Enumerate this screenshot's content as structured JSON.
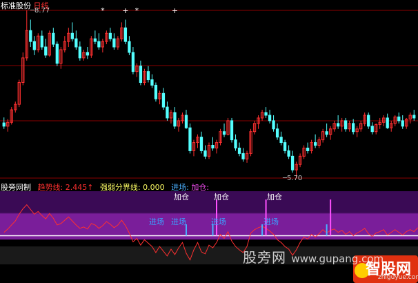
{
  "top_bar": {
    "indicator_name": "标准股份",
    "period": "日线"
  },
  "price_panel": {
    "high_label": "8.77",
    "low_label": "5.70",
    "markers": [
      "*",
      "+",
      "*",
      "+",
      "+"
    ]
  },
  "indicator_panel": {
    "name": "股旁网制",
    "trend_label": "趋势线:",
    "trend_value": "2.445↑",
    "boundary_label": "强弱分界线:",
    "boundary_value": "0.000",
    "entry_label": "进场:",
    "add_label": "加仓:",
    "add_marks": [
      "加仓",
      "加仓",
      "加仓"
    ],
    "entry_marks": [
      "进场",
      "进场",
      "进场",
      "进场"
    ]
  },
  "watermark": {
    "site_name": "股旁网",
    "url": "www.gupang.com"
  },
  "logo": {
    "main": "智股网",
    "sub": "zhiguyue.com"
  },
  "colors": {
    "background": "#000000",
    "up_candle": "#ff3030",
    "down_candle": "#54ffff",
    "grid": "#8b0000",
    "band_dark": "#3a0a55",
    "band_light": "#7a1e9a",
    "trend_line": "#ff3030",
    "boundary_line": "#ffffff",
    "add_signal": "#ff50ff",
    "entry_signal": "#4ab0ff",
    "title_text": "#ffffff",
    "period_text": "#ff3030",
    "trend_text": "#ff3030",
    "boundary_text": "#ffff66",
    "entry_text": "#4ab0ff",
    "add_text": "#ff50ff"
  },
  "chart_data": {
    "type": "candlestick",
    "price_high": 8.77,
    "price_low": 5.7,
    "ohlc": [
      [
        6.71,
        6.81,
        6.6,
        6.65
      ],
      [
        6.65,
        6.78,
        6.55,
        6.72
      ],
      [
        6.72,
        7.0,
        6.68,
        6.95
      ],
      [
        6.95,
        7.1,
        6.9,
        7.05
      ],
      [
        7.05,
        7.5,
        7.0,
        7.45
      ],
      [
        7.45,
        8.0,
        7.4,
        7.9
      ],
      [
        7.9,
        8.77,
        7.85,
        8.4
      ],
      [
        8.4,
        8.6,
        8.1,
        8.2
      ],
      [
        8.2,
        8.3,
        7.95,
        8.05
      ],
      [
        8.05,
        8.35,
        8.0,
        8.3
      ],
      [
        8.3,
        8.4,
        8.05,
        8.1
      ],
      [
        8.1,
        8.25,
        7.9,
        7.95
      ],
      [
        7.95,
        8.4,
        7.92,
        8.35
      ],
      [
        8.35,
        8.45,
        8.1,
        8.15
      ],
      [
        8.15,
        8.2,
        7.75,
        7.8
      ],
      [
        7.8,
        8.1,
        7.7,
        8.05
      ],
      [
        8.05,
        8.3,
        8.0,
        8.2
      ],
      [
        8.2,
        8.45,
        8.1,
        8.35
      ],
      [
        8.35,
        8.55,
        8.2,
        8.25
      ],
      [
        8.25,
        8.4,
        8.05,
        8.1
      ],
      [
        8.1,
        8.2,
        7.85,
        7.9
      ],
      [
        7.9,
        8.05,
        7.85,
        8.0
      ],
      [
        8.0,
        8.1,
        7.88,
        7.95
      ],
      [
        7.95,
        8.3,
        7.9,
        8.25
      ],
      [
        8.25,
        8.4,
        8.15,
        8.2
      ],
      [
        8.2,
        8.35,
        8.05,
        8.1
      ],
      [
        8.1,
        8.25,
        8.0,
        8.2
      ],
      [
        8.2,
        8.4,
        8.15,
        8.35
      ],
      [
        8.35,
        8.45,
        8.2,
        8.25
      ],
      [
        8.25,
        8.35,
        8.05,
        8.1
      ],
      [
        8.1,
        8.3,
        8.05,
        8.25
      ],
      [
        8.25,
        8.55,
        8.2,
        8.45
      ],
      [
        8.45,
        8.6,
        8.15,
        8.2
      ],
      [
        8.2,
        8.3,
        7.95,
        8.0
      ],
      [
        8.0,
        8.1,
        7.6,
        7.65
      ],
      [
        7.65,
        7.8,
        7.55,
        7.75
      ],
      [
        7.75,
        7.85,
        7.4,
        7.45
      ],
      [
        7.45,
        7.7,
        7.4,
        7.65
      ],
      [
        7.65,
        7.75,
        7.45,
        7.5
      ],
      [
        7.5,
        7.6,
        7.35,
        7.4
      ],
      [
        7.4,
        7.45,
        7.1,
        7.15
      ],
      [
        7.15,
        7.3,
        7.05,
        7.25
      ],
      [
        7.25,
        7.35,
        6.95,
        7.0
      ],
      [
        7.0,
        7.1,
        6.75,
        6.8
      ],
      [
        6.8,
        6.95,
        6.7,
        6.9
      ],
      [
        6.9,
        7.0,
        6.6,
        6.65
      ],
      [
        6.65,
        6.8,
        6.55,
        6.75
      ],
      [
        6.75,
        6.9,
        6.7,
        6.85
      ],
      [
        6.85,
        6.95,
        6.6,
        6.62
      ],
      [
        6.62,
        6.7,
        6.15,
        6.2
      ],
      [
        6.2,
        6.4,
        6.1,
        6.35
      ],
      [
        6.35,
        6.5,
        6.25,
        6.45
      ],
      [
        6.45,
        6.55,
        6.15,
        6.2
      ],
      [
        6.2,
        6.3,
        6.05,
        6.1
      ],
      [
        6.1,
        6.35,
        6.05,
        6.3
      ],
      [
        6.3,
        6.45,
        6.2,
        6.25
      ],
      [
        6.25,
        6.4,
        6.15,
        6.35
      ],
      [
        6.35,
        6.6,
        6.3,
        6.55
      ],
      [
        6.55,
        6.7,
        6.45,
        6.5
      ],
      [
        6.5,
        6.8,
        6.48,
        6.75
      ],
      [
        6.75,
        6.8,
        6.35,
        6.4
      ],
      [
        6.4,
        6.5,
        6.2,
        6.25
      ],
      [
        6.25,
        6.35,
        6.1,
        6.15
      ],
      [
        6.15,
        6.25,
        6.0,
        6.05
      ],
      [
        6.05,
        6.2,
        5.98,
        6.15
      ],
      [
        6.15,
        6.6,
        6.1,
        6.55
      ],
      [
        6.55,
        6.75,
        6.5,
        6.7
      ],
      [
        6.7,
        6.85,
        6.6,
        6.8
      ],
      [
        6.8,
        6.95,
        6.75,
        6.9
      ],
      [
        6.9,
        7.0,
        6.8,
        6.85
      ],
      [
        6.85,
        6.95,
        6.7,
        6.75
      ],
      [
        6.75,
        6.85,
        6.55,
        6.6
      ],
      [
        6.6,
        6.7,
        6.4,
        6.45
      ],
      [
        6.45,
        6.55,
        6.3,
        6.35
      ],
      [
        6.35,
        6.4,
        6.15,
        6.2
      ],
      [
        6.2,
        6.3,
        6.05,
        6.1
      ],
      [
        6.1,
        6.2,
        5.8,
        5.85
      ],
      [
        5.85,
        6.0,
        5.7,
        5.95
      ],
      [
        5.95,
        6.15,
        5.9,
        6.1
      ],
      [
        6.1,
        6.3,
        6.05,
        6.25
      ],
      [
        6.25,
        6.35,
        6.15,
        6.2
      ],
      [
        6.2,
        6.4,
        6.15,
        6.35
      ],
      [
        6.35,
        6.5,
        6.25,
        6.3
      ],
      [
        6.3,
        6.45,
        6.25,
        6.4
      ],
      [
        6.4,
        6.6,
        6.35,
        6.55
      ],
      [
        6.55,
        6.7,
        6.45,
        6.5
      ],
      [
        6.5,
        6.65,
        6.4,
        6.6
      ],
      [
        6.6,
        6.75,
        6.55,
        6.7
      ],
      [
        6.7,
        6.85,
        6.6,
        6.65
      ],
      [
        6.65,
        6.8,
        6.55,
        6.75
      ],
      [
        6.75,
        6.8,
        6.55,
        6.6
      ],
      [
        6.6,
        6.75,
        6.55,
        6.7
      ],
      [
        6.7,
        6.78,
        6.5,
        6.55
      ],
      [
        6.55,
        6.65,
        6.45,
        6.6
      ],
      [
        6.6,
        6.75,
        6.55,
        6.7
      ],
      [
        6.7,
        6.9,
        6.65,
        6.85
      ],
      [
        6.85,
        6.9,
        6.6,
        6.65
      ],
      [
        6.65,
        6.72,
        6.5,
        6.55
      ],
      [
        6.55,
        6.7,
        6.5,
        6.68
      ],
      [
        6.68,
        6.8,
        6.6,
        6.72
      ],
      [
        6.72,
        6.85,
        6.65,
        6.8
      ],
      [
        6.8,
        6.88,
        6.6,
        6.62
      ],
      [
        6.62,
        6.75,
        6.55,
        6.7
      ],
      [
        6.7,
        6.85,
        6.65,
        6.82
      ],
      [
        6.82,
        6.9,
        6.7,
        6.75
      ],
      [
        6.75,
        6.85,
        6.6,
        6.65
      ],
      [
        6.65,
        6.8,
        6.6,
        6.78
      ],
      [
        6.78,
        6.9,
        6.7,
        6.85
      ],
      [
        6.85,
        6.95,
        6.75,
        6.8
      ]
    ],
    "trend_series": [
      0.5,
      1.0,
      1.6,
      2.2,
      3.2,
      4.0,
      4.6,
      3.9,
      3.2,
      3.6,
      3.0,
      2.5,
      3.3,
      2.6,
      1.6,
      1.8,
      2.3,
      2.8,
      2.2,
      1.6,
      1.1,
      1.3,
      1.0,
      1.8,
      1.6,
      1.1,
      1.5,
      2.1,
      1.7,
      1.2,
      1.6,
      2.3,
      1.5,
      0.4,
      -0.9,
      -0.4,
      -1.4,
      -0.6,
      -1.1,
      -1.6,
      -2.5,
      -1.6,
      -2.3,
      -3.0,
      -2.0,
      -2.8,
      -1.8,
      -1.0,
      -2.6,
      -3.6,
      -2.1,
      -1.0,
      -2.4,
      -2.7,
      -1.4,
      -1.8,
      -1.0,
      0.2,
      -0.4,
      0.6,
      -0.8,
      -1.6,
      -2.1,
      -2.5,
      -1.6,
      0.4,
      0.9,
      1.2,
      1.4,
      1.1,
      0.7,
      0.2,
      -0.6,
      -1.0,
      -1.6,
      -2.0,
      -2.9,
      -2.1,
      -1.0,
      -0.2,
      -0.5,
      0.2,
      -0.2,
      0.3,
      0.9,
      0.4,
      0.8,
      1.0,
      0.5,
      0.8,
      0.2,
      0.6,
      0.0,
      0.4,
      0.7,
      1.1,
      0.3,
      -0.1,
      0.4,
      0.6,
      0.9,
      0.1,
      0.5,
      0.9,
      0.5,
      0.1,
      0.6,
      0.9,
      0.6,
      1.2
    ],
    "trend_range": [
      -6,
      6
    ],
    "boundary_value": 0.0,
    "add_signal_indices": [
      56,
      69,
      86
    ],
    "entry_signal_indices": [
      48,
      55,
      68,
      85
    ]
  }
}
